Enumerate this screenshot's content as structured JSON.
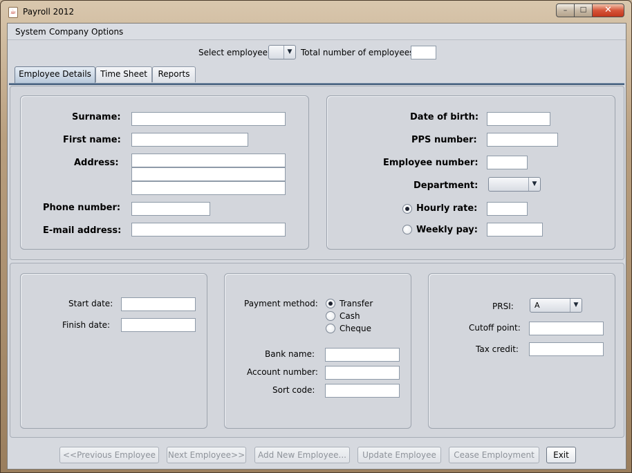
{
  "window": {
    "title": "Payroll 2012",
    "icon": "java-app-icon",
    "controls": {
      "minimize": "–",
      "maximize": "☐",
      "close": "✕"
    }
  },
  "menu": [
    "System",
    "Company",
    "Options"
  ],
  "top": {
    "select_employee_label": "Select employee:",
    "select_employee_value": "",
    "total_label": "Total number of employees:",
    "total_value": ""
  },
  "tabs": [
    {
      "label": "Employee Details",
      "active": true
    },
    {
      "label": "Time Sheet",
      "active": false
    },
    {
      "label": "Reports",
      "active": false
    }
  ],
  "personal": {
    "surname_label": "Surname:",
    "first_name_label": "First name:",
    "address_label": "Address:",
    "phone_label": "Phone number:",
    "email_label": "E-mail address:"
  },
  "employment": {
    "dob_label": "Date of birth:",
    "pps_label": "PPS number:",
    "emp_number_label": "Employee number:",
    "department_label": "Department:",
    "department_value": "",
    "hourly_label": "Hourly rate:",
    "weekly_label": "Weekly pay:",
    "pay_type_selected": "hourly"
  },
  "dates": {
    "start_label": "Start date:",
    "finish_label": "Finish date:"
  },
  "payment": {
    "method_label": "Payment method:",
    "options": [
      "Transfer",
      "Cash",
      "Cheque"
    ],
    "selected": "Transfer",
    "bank_label": "Bank name:",
    "account_label": "Account number:",
    "sort_label": "Sort code:"
  },
  "tax": {
    "prsi_label": "PRSI:",
    "prsi_value": "A",
    "cutoff_label": "Cutoff point:",
    "credit_label": "Tax credit:"
  },
  "buttons": {
    "previous": "<<Previous Employee",
    "next": "Next Employee>>",
    "add": "Add New Employee...",
    "update": "Update Employee",
    "cease": "Cease Employment",
    "exit": "Exit"
  }
}
